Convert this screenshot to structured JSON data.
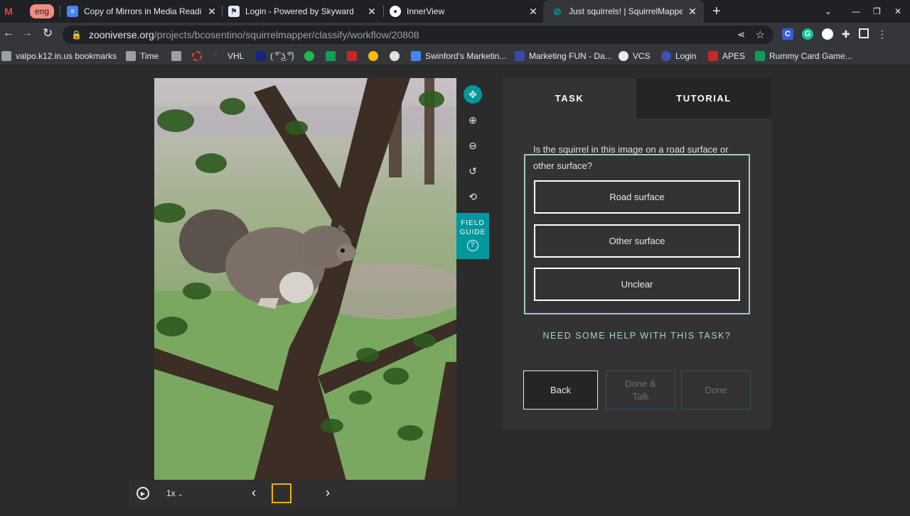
{
  "browser": {
    "tabs": [
      {
        "icon": "gmail-icon",
        "title": ""
      },
      {
        "icon": "eng-badge",
        "title": "eng"
      },
      {
        "icon": "google-docs-icon",
        "title": "Copy of Mirrors in Media Reading"
      },
      {
        "icon": "skyward-icon",
        "title": "Login - Powered by Skyward"
      },
      {
        "icon": "innerview-icon",
        "title": "InnerView"
      },
      {
        "icon": "zooniverse-icon",
        "title": "Just squirrels! | SquirrelMapper |"
      }
    ],
    "url_host": "zooniverse.org",
    "url_path": "/projects/bcosentino/squirrelmapper/classify/workflow/20808",
    "bookmarks": [
      "valpo.k12.in.us bookmarks",
      "Time",
      "",
      "",
      "VHL",
      "( ͡° ͜ʖ ͡°)",
      "",
      "",
      "",
      "",
      "",
      "Swinford's Marketin...",
      "Marketing FUN - Da...",
      "VCS",
      "Login",
      "APES",
      "Rummy Card Game..."
    ]
  },
  "viewer": {
    "speed": "1x",
    "field_guide": "FIELD GUIDE",
    "image_alt": "gray squirrel on tree branch"
  },
  "panel": {
    "tab_task": "TASK",
    "tab_tutorial": "TUTORIAL",
    "question": "Is the squirrel in this image on a road surface or other surface?",
    "answers": [
      "Road surface",
      "Other surface",
      "Unclear"
    ],
    "help": "NEED SOME HELP WITH THIS TASK?",
    "back": "Back",
    "done_talk": "Done & Talk",
    "done": "Done"
  },
  "colors": {
    "accent": "#00979d",
    "help_text": "#9fd4d8",
    "panel_bg": "#333333",
    "page_bg": "#2b2b2b"
  }
}
